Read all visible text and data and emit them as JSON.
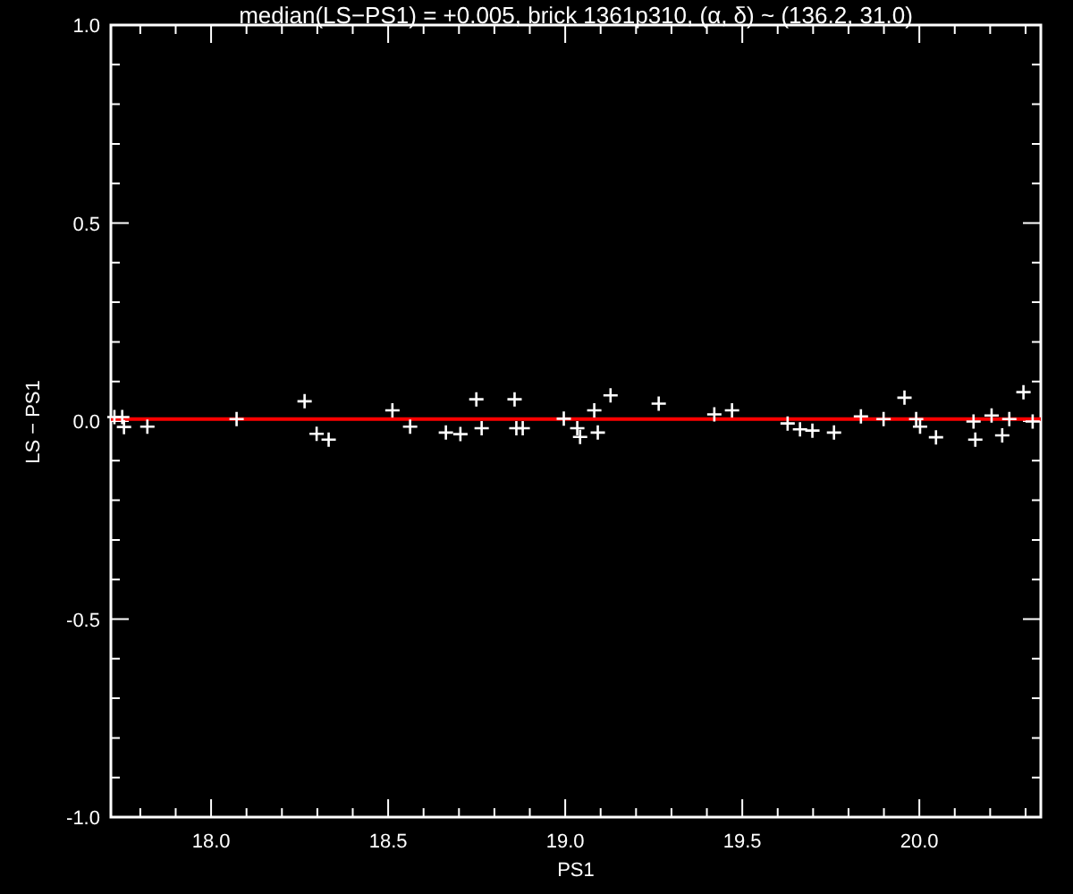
{
  "chart_data": {
    "type": "scatter",
    "title": "median(LS−PS1) = +0.005, brick 1361p310, (α, δ) ~ (136.2, 31.0)",
    "xlabel": "PS1",
    "ylabel": "LS − PS1",
    "x": [
      17.727,
      17.749,
      17.754,
      17.82,
      18.072,
      18.264,
      18.298,
      18.332,
      18.512,
      18.562,
      18.663,
      18.704,
      18.749,
      18.764,
      18.857,
      18.862,
      18.88,
      18.996,
      19.034,
      19.042,
      19.082,
      19.092,
      19.128,
      19.264,
      19.421,
      19.471,
      19.628,
      19.663,
      19.698,
      19.759,
      19.835,
      19.899,
      19.958,
      19.991,
      20.002,
      20.047,
      20.153,
      20.158,
      20.204,
      20.234,
      20.254,
      20.294,
      20.32
    ],
    "series": [
      {
        "color": "#ffffff",
        "values": [
          0.01,
          0.01,
          -0.015,
          -0.014,
          0.005,
          0.05,
          -0.032,
          -0.047,
          0.027,
          -0.014,
          -0.029,
          -0.033,
          0.055,
          -0.018,
          0.055,
          -0.018,
          -0.018,
          0.006,
          -0.018,
          -0.04,
          0.027,
          -0.029,
          0.065,
          0.044,
          0.017,
          0.027,
          -0.006,
          -0.021,
          -0.024,
          -0.029,
          0.012,
          0.005,
          0.059,
          0.005,
          -0.014,
          -0.041,
          -0.001,
          -0.047,
          0.014,
          -0.036,
          0.005,
          0.073,
          -0.001
        ]
      }
    ],
    "xlim": [
      17.717,
      20.343
    ],
    "ylim": [
      -1.0,
      1.0
    ],
    "xticks": [
      {
        "value": 18.0,
        "label": "18.0"
      },
      {
        "value": 18.5,
        "label": "18.5"
      },
      {
        "value": 19.0,
        "label": "19.0"
      },
      {
        "value": 19.5,
        "label": "19.5"
      },
      {
        "value": 20.0,
        "label": "20.0"
      }
    ],
    "yticks": [
      {
        "value": -1.0,
        "label": "-1.0"
      },
      {
        "value": -0.5,
        "label": "-0.5"
      },
      {
        "value": 0.0,
        "label": "0.0"
      },
      {
        "value": 0.5,
        "label": "0.5"
      },
      {
        "value": 1.0,
        "label": "1.0"
      }
    ],
    "ref_lines": [
      {
        "axis": "y",
        "value": 0.005,
        "color": "#ff0000"
      }
    ]
  }
}
